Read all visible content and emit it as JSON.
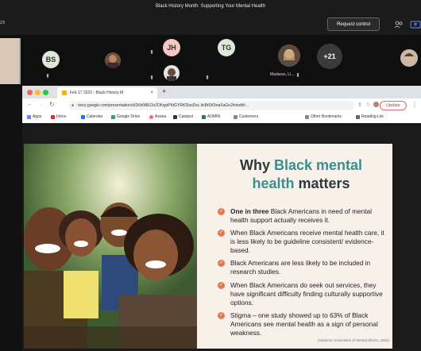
{
  "meeting": {
    "title": "Black History Month: Supporting Your Mental Health",
    "time_stub": "23",
    "request_control_label": "Request control",
    "people_icon": "people-icon",
    "share_icon": "share-icon"
  },
  "participants": [
    {
      "initials": "BS",
      "color": "#dde8d8",
      "text_color": "#333"
    },
    {
      "initials": "JH",
      "color": "#f4c7c0",
      "text_color": "#333"
    },
    {
      "initials": "TG",
      "color": "#dde8d8",
      "text_color": "#333"
    },
    {
      "initials": "+21",
      "color": "#3a3a3a",
      "text_color": "#fff"
    }
  ],
  "participant_name": "Madaras, Li...",
  "browser": {
    "tab_title": "Feb 17 2022 - Black History M",
    "new_tab": "+",
    "url": "docs.google.com/presentation/d/1Kb5BEOn2OfvgsPKtGYRKf2usDsc.ilcBtSK9naXaGe2fs/edit#...",
    "update_label": "Update",
    "bookmarks": [
      {
        "label": "Apps",
        "color": "#5b8def"
      },
      {
        "label": "Inbox",
        "color": "#d93025"
      },
      {
        "label": "Calendar",
        "color": "#1a73e8"
      },
      {
        "label": "Google Drive",
        "color": "#34a853"
      },
      {
        "label": "Asana",
        "color": "#f06a6a"
      },
      {
        "label": "Catalyst",
        "color": "#333333"
      },
      {
        "label": "ADMIN",
        "color": "#2e7d32"
      },
      {
        "label": "Customers",
        "color": "#888888"
      }
    ],
    "other_bookmarks": "Other Bookmarks",
    "reading_list": "Reading List"
  },
  "slide": {
    "title_part1": "Why ",
    "title_accent": "Black mental health",
    "title_part2": " matters",
    "bullets": [
      {
        "bold": "One in three",
        "text": " Black Americans in need of mental health support actually receives it."
      },
      {
        "bold": "",
        "text": "When Black Americans receive mental health care, it is less likely to be guideline consistent/ evidence-based."
      },
      {
        "bold": "",
        "text": "Black Americans are less likely to be included in research studies."
      },
      {
        "bold": "",
        "text": "When Black Americans do seek out services, they have significant difficulty finding culturally supportive options."
      },
      {
        "bold": "",
        "text": "Stigma – one study showed up to 63% of Black Americans see mental health as a sign of personal weakness."
      }
    ],
    "citation": "(National Association of Mental Illness, 2022)",
    "accent_color": "#3a8f8a",
    "bullet_color": "#e07a52"
  }
}
